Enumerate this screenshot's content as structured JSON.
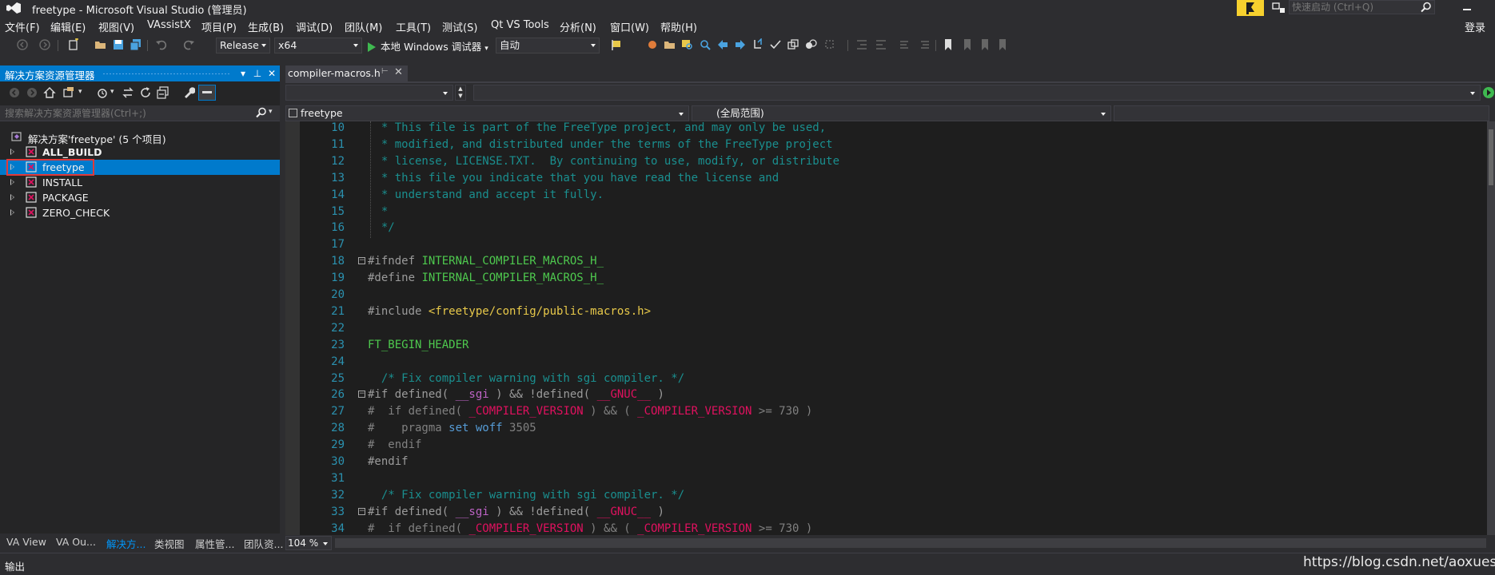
{
  "window": {
    "title": "freetype - Microsoft Visual Studio (管理员)",
    "quick_launch_placeholder": "快速启动 (Ctrl+Q)",
    "login": "登录"
  },
  "menu": [
    "文件(F)",
    "编辑(E)",
    "视图(V)",
    "VAssistX",
    "项目(P)",
    "生成(B)",
    "调试(D)",
    "团队(M)",
    "工具(T)",
    "测试(S)",
    "Qt VS Tools",
    "分析(N)",
    "窗口(W)",
    "帮助(H)"
  ],
  "toolbar": {
    "config": "Release",
    "platform": "x64",
    "run_label": "本地 Windows 调试器",
    "run_mode": "自动"
  },
  "solution_explorer": {
    "title": "解决方案资源管理器",
    "search_placeholder": "搜索解决方案资源管理器(Ctrl+;)",
    "root": "解决方案'freetype' (5 个项目)",
    "items": [
      {
        "label": "ALL_BUILD",
        "bold": true,
        "selected": false
      },
      {
        "label": "freetype",
        "bold": false,
        "selected": true
      },
      {
        "label": "INSTALL",
        "bold": false,
        "selected": false
      },
      {
        "label": "PACKAGE",
        "bold": false,
        "selected": false
      },
      {
        "label": "ZERO_CHECK",
        "bold": false,
        "selected": false
      }
    ],
    "bottom_tabs": [
      "VA View",
      "VA Ou...",
      "解决方...",
      "类视图",
      "属性管...",
      "团队资..."
    ]
  },
  "editor": {
    "tab_label": "compiler-macros.h",
    "project_combo": "freetype",
    "scope_combo": "(全局范围)",
    "zoom": "104 %",
    "lines": [
      {
        "n": "10",
        "segs": [
          {
            "t": "* This file is part of the FreeType project, and may only be used,",
            "c": "c-com2"
          }
        ],
        "pad": "  "
      },
      {
        "n": "11",
        "segs": [
          {
            "t": "* modified, and distributed under the terms of the FreeType project",
            "c": "c-com2"
          }
        ],
        "pad": "  "
      },
      {
        "n": "12",
        "segs": [
          {
            "t": "* license, LICENSE.TXT.  By continuing to use, modify, or distribute",
            "c": "c-com2"
          }
        ],
        "pad": "  "
      },
      {
        "n": "13",
        "segs": [
          {
            "t": "* this file you indicate that you have read the license and",
            "c": "c-com2"
          }
        ],
        "pad": "  "
      },
      {
        "n": "14",
        "segs": [
          {
            "t": "* understand and accept it fully.",
            "c": "c-com2"
          }
        ],
        "pad": "  "
      },
      {
        "n": "15",
        "segs": [
          {
            "t": "*",
            "c": "c-com2"
          }
        ],
        "pad": "  "
      },
      {
        "n": "16",
        "segs": [
          {
            "t": "*/",
            "c": "c-com2"
          }
        ],
        "pad": "  "
      },
      {
        "n": "17",
        "segs": [],
        "pad": ""
      },
      {
        "n": "18",
        "fold": true,
        "segs": [
          {
            "t": "#ifndef ",
            "c": "c-pre"
          },
          {
            "t": "INTERNAL_COMPILER_MACROS_H_",
            "c": "c-green"
          }
        ],
        "pad": ""
      },
      {
        "n": "19",
        "segs": [
          {
            "t": "#define ",
            "c": "c-pre"
          },
          {
            "t": "INTERNAL_COMPILER_MACROS_H_",
            "c": "c-green"
          }
        ],
        "pad": ""
      },
      {
        "n": "20",
        "segs": [],
        "pad": ""
      },
      {
        "n": "21",
        "segs": [
          {
            "t": "#include ",
            "c": "c-pre"
          },
          {
            "t": "<freetype/config/public-macros.h>",
            "c": "c-inc"
          }
        ],
        "pad": ""
      },
      {
        "n": "22",
        "segs": [],
        "pad": ""
      },
      {
        "n": "23",
        "segs": [
          {
            "t": "FT_BEGIN_HEADER",
            "c": "c-green"
          }
        ],
        "pad": ""
      },
      {
        "n": "24",
        "segs": [],
        "pad": ""
      },
      {
        "n": "25",
        "segs": [
          {
            "t": "  /* Fix compiler warning with sgi compiler. */",
            "c": "c-com2"
          }
        ],
        "pad": ""
      },
      {
        "n": "26",
        "fold": true,
        "segs": [
          {
            "t": "#if defined( ",
            "c": "c-pre"
          },
          {
            "t": "__sgi",
            "c": "c-mac"
          },
          {
            "t": " ) && !defined( ",
            "c": "c-pre"
          },
          {
            "t": "__GNUC__",
            "c": "c-mac2"
          },
          {
            "t": " )",
            "c": "c-pre"
          }
        ],
        "pad": ""
      },
      {
        "n": "27",
        "segs": [
          {
            "t": "#  if defined( ",
            "c": "c-dim"
          },
          {
            "t": "_COMPILER_VERSION",
            "c": "c-mac2"
          },
          {
            "t": " ) && ( ",
            "c": "c-dim"
          },
          {
            "t": "_COMPILER_VERSION",
            "c": "c-mac2"
          },
          {
            "t": " >= 730 )",
            "c": "c-dim"
          }
        ],
        "pad": ""
      },
      {
        "n": "28",
        "segs": [
          {
            "t": "#    pragma ",
            "c": "c-dim"
          },
          {
            "t": "set woff",
            "c": "c-kw"
          },
          {
            "t": " 3505",
            "c": "c-dim"
          }
        ],
        "pad": ""
      },
      {
        "n": "29",
        "segs": [
          {
            "t": "#  endif",
            "c": "c-dim"
          }
        ],
        "pad": ""
      },
      {
        "n": "30",
        "segs": [
          {
            "t": "#endif",
            "c": "c-pre"
          }
        ],
        "pad": ""
      },
      {
        "n": "31",
        "segs": [],
        "pad": ""
      },
      {
        "n": "32",
        "segs": [
          {
            "t": "  /* Fix compiler warning with sgi compiler. */",
            "c": "c-com2"
          }
        ],
        "pad": ""
      },
      {
        "n": "33",
        "fold": true,
        "segs": [
          {
            "t": "#if defined( ",
            "c": "c-pre"
          },
          {
            "t": "__sgi",
            "c": "c-mac"
          },
          {
            "t": " ) && !defined( ",
            "c": "c-pre"
          },
          {
            "t": "__GNUC__",
            "c": "c-mac2"
          },
          {
            "t": " )",
            "c": "c-pre"
          }
        ],
        "pad": ""
      },
      {
        "n": "34",
        "segs": [
          {
            "t": "#  if defined( ",
            "c": "c-dim"
          },
          {
            "t": "_COMPILER_VERSION",
            "c": "c-mac2"
          },
          {
            "t": " ) && ( ",
            "c": "c-dim"
          },
          {
            "t": "_COMPILER_VERSION",
            "c": "c-mac2"
          },
          {
            "t": " >= 730 )",
            "c": "c-dim"
          }
        ],
        "pad": ""
      }
    ]
  },
  "output_label": "输出",
  "watermark": "https://blog.csdn.net/aoxuestudy",
  "colors": {
    "accent": "#007acc",
    "selection_box": "#e03a3a",
    "notify_flag": "#f7d12e"
  }
}
